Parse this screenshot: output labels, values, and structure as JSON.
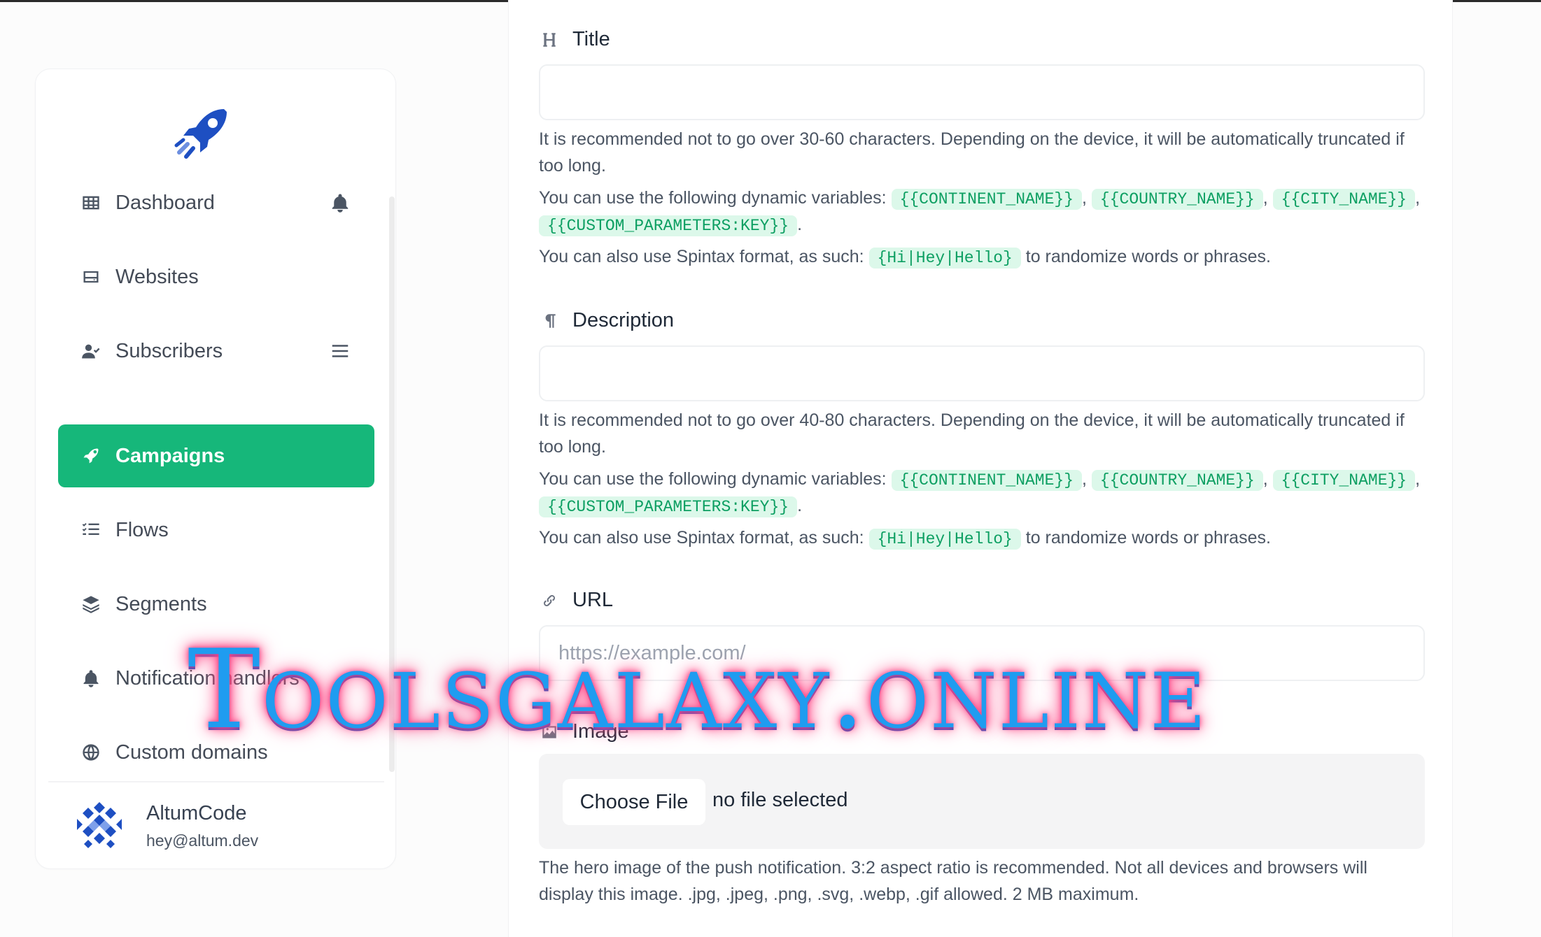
{
  "sidebar": {
    "items": [
      {
        "label": "Dashboard",
        "icon": "table-icon"
      },
      {
        "label": "Websites",
        "icon": "hdd-icon"
      },
      {
        "label": "Subscribers",
        "icon": "user-check-icon"
      },
      {
        "label": "Campaigns",
        "icon": "rocket-icon",
        "active": true
      },
      {
        "label": "Flows",
        "icon": "tasks-icon"
      },
      {
        "label": "Segments",
        "icon": "layers-icon"
      },
      {
        "label": "Notification handlers",
        "icon": "bell-icon"
      },
      {
        "label": "Custom domains",
        "icon": "globe-icon"
      }
    ],
    "user": {
      "name": "AltumCode",
      "email": "hey@altum.dev"
    }
  },
  "form": {
    "title": {
      "label": "Title",
      "value": "",
      "help_limit": "It is recommended not to go over 30-60 characters. Depending on the device, it will be automatically truncated if too long.",
      "help_vars_prefix": "You can use the following dynamic variables:",
      "variables": [
        "{{CONTINENT_NAME}}",
        "{{COUNTRY_NAME}}",
        "{{CITY_NAME}}",
        "{{CUSTOM_PARAMETERS:KEY}}"
      ],
      "help_spintax_prefix": "You can also use Spintax format, as such:",
      "spintax": "{Hi|Hey|Hello}",
      "help_spintax_suffix": "to randomize words or phrases."
    },
    "description": {
      "label": "Description",
      "value": "",
      "help_limit": "It is recommended not to go over 40-80 characters. Depending on the device, it will be automatically truncated if too long.",
      "help_vars_prefix": "You can use the following dynamic variables:",
      "variables": [
        "{{CONTINENT_NAME}}",
        "{{COUNTRY_NAME}}",
        "{{CITY_NAME}}",
        "{{CUSTOM_PARAMETERS:KEY}}"
      ],
      "help_spintax_prefix": "You can also use Spintax format, as such:",
      "spintax": "{Hi|Hey|Hello}",
      "help_spintax_suffix": "to randomize words or phrases."
    },
    "url": {
      "label": "URL",
      "placeholder": "https://example.com/"
    },
    "image": {
      "label": "Image",
      "choose_label": "Choose File",
      "status": "no file selected",
      "help": "The hero image of the push notification. 3:2 aspect ratio is recommended. Not all devices and browsers will display this image. .jpg, .jpeg, .png, .svg, .webp, .gif allowed. 2 MB maximum."
    }
  },
  "watermark": "Toolsgalaxy.online",
  "colors": {
    "accent": "#16b77a",
    "code_bg": "#dcf8ea",
    "code_text": "#0d9f62"
  }
}
